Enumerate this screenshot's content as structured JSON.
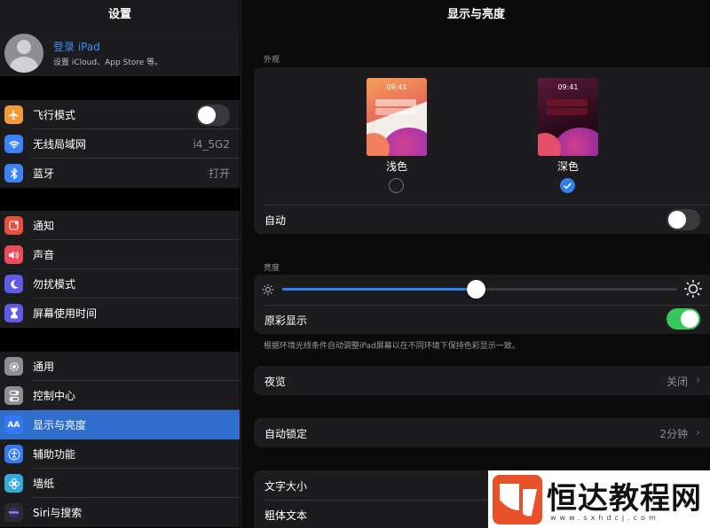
{
  "sidebar": {
    "title": "设置",
    "profile": {
      "name": "登录 iPad",
      "subtitle": "设置 iCloud、App Store 等。"
    },
    "group1": [
      {
        "label": "飞行模式",
        "icon": "airplane-icon",
        "color": "#f19a37",
        "toggle": false
      },
      {
        "label": "无线局域网",
        "icon": "wifi-icon",
        "color": "#3b82f6",
        "value": "i4_5G2"
      },
      {
        "label": "蓝牙",
        "icon": "bluetooth-icon",
        "color": "#3b82f6",
        "value": "打开"
      }
    ],
    "group2": [
      {
        "label": "通知",
        "icon": "notification-icon",
        "color": "#eb4d3d"
      },
      {
        "label": "声音",
        "icon": "speaker-icon",
        "color": "#eb4d5f"
      },
      {
        "label": "勿扰模式",
        "icon": "moon-icon",
        "color": "#5e5ce6"
      },
      {
        "label": "屏幕使用时间",
        "icon": "hourglass-icon",
        "color": "#5e5ce6"
      }
    ],
    "group3": [
      {
        "label": "通用",
        "icon": "gear-icon",
        "color": "#8e8e93"
      },
      {
        "label": "控制中心",
        "icon": "toggles-icon",
        "color": "#8e8e93"
      },
      {
        "label": "显示与亮度",
        "icon": "text-size-icon",
        "color": "#3478f6",
        "selected": true
      },
      {
        "label": "辅助功能",
        "icon": "accessibility-icon",
        "color": "#3478f6"
      },
      {
        "label": "墙纸",
        "icon": "flower-icon",
        "color": "#37aadc"
      },
      {
        "label": "Siri与搜索",
        "icon": "siri-icon",
        "color": "#2b2b2f"
      }
    ]
  },
  "main": {
    "title": "显示与亮度",
    "appearance": {
      "section_label": "外观",
      "light": {
        "label": "浅色",
        "time": "09:41",
        "selected": false
      },
      "dark": {
        "label": "深色",
        "time": "09:41",
        "selected": true
      },
      "auto_label": "自动",
      "auto_on": false
    },
    "brightness": {
      "section_label": "亮度",
      "level": 0.49,
      "true_tone_label": "原彩显示",
      "true_tone_on": true,
      "note": "根据环境光线条件自动调整iPad屏幕以在不同环境下保持色彩显示一致。"
    },
    "night_shift": {
      "label": "夜览",
      "value": "关闭"
    },
    "auto_lock": {
      "label": "自动锁定",
      "value": "2分钟"
    },
    "text_size": {
      "label": "文字大小"
    },
    "bold_text": {
      "label": "粗体文本"
    }
  },
  "watermark": {
    "text": "恒达教程网",
    "url": "www.sxhdcj.com"
  },
  "colors": {
    "accent": "#2f80ed",
    "toggle_on": "#34c759",
    "link": "#3a8ef6"
  }
}
